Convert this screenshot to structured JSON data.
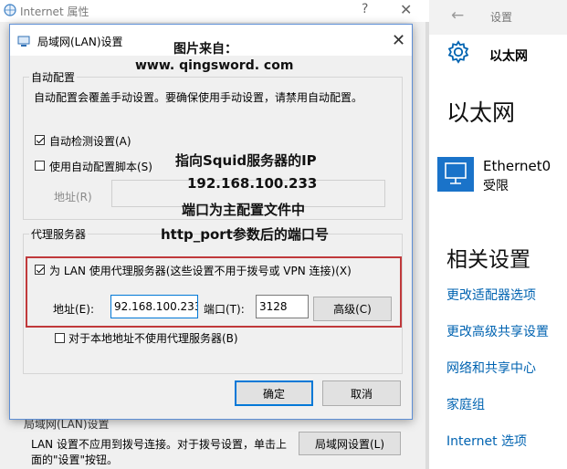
{
  "background_window": {
    "title": "Internet 属性",
    "help_glyph": "?",
    "close_glyph": "✕",
    "lan_group_label": "局域网(LAN)设置",
    "lan_description": "LAN 设置不应用到拨号连接。对于拨号设置，单击上面的\"设置\"按钮。",
    "lan_settings_button": "局域网设置(L)"
  },
  "lan_dialog": {
    "title": "局域网(LAN)设置",
    "close_glyph": "✕",
    "auto_config": {
      "legend": "自动配置",
      "description": "自动配置会覆盖手动设置。要确保使用手动设置，请禁用自动配置。",
      "auto_detect_label": "自动检测设置(A)",
      "auto_detect_checked": true,
      "use_script_label": "使用自动配置脚本(S)",
      "use_script_checked": false,
      "address_label": "地址(R)",
      "address_value": ""
    },
    "proxy": {
      "legend": "代理服务器",
      "use_proxy_label": "为 LAN 使用代理服务器(这些设置不用于拨号或 VPN 连接)(X)",
      "use_proxy_checked": true,
      "address_label": "地址(E):",
      "address_value": "92.168.100.233",
      "port_label": "端口(T):",
      "port_value": "3128",
      "advanced_button": "高级(C)",
      "bypass_local_label": "对于本地地址不使用代理服务器(B)",
      "bypass_local_checked": false
    },
    "ok_button": "确定",
    "cancel_button": "取消"
  },
  "annotations": {
    "source_line1": "图片来自：",
    "source_line2": "www. qingsword. com",
    "note_line1": "指向Squid服务器的IP",
    "note_line2": "192.168.100.233",
    "note_line3": "端口为主配置文件中",
    "note_line4": "http_port参数后的端口号"
  },
  "settings_panel": {
    "back_glyph": "←",
    "title": "设置",
    "home_label": "以太网",
    "heading": "以太网",
    "ethernet_name": "Ethernet0",
    "ethernet_status": "受限",
    "related_heading": "相关设置",
    "links": [
      "更改适配器选项",
      "更改高级共享设置",
      "网络和共享中心",
      "家庭组",
      "Internet 选项"
    ]
  },
  "colors": {
    "accent_blue": "#0078d7",
    "link_blue": "#0063b1",
    "highlight_red": "#c0393b",
    "ethernet_tile": "#1a73c9"
  }
}
